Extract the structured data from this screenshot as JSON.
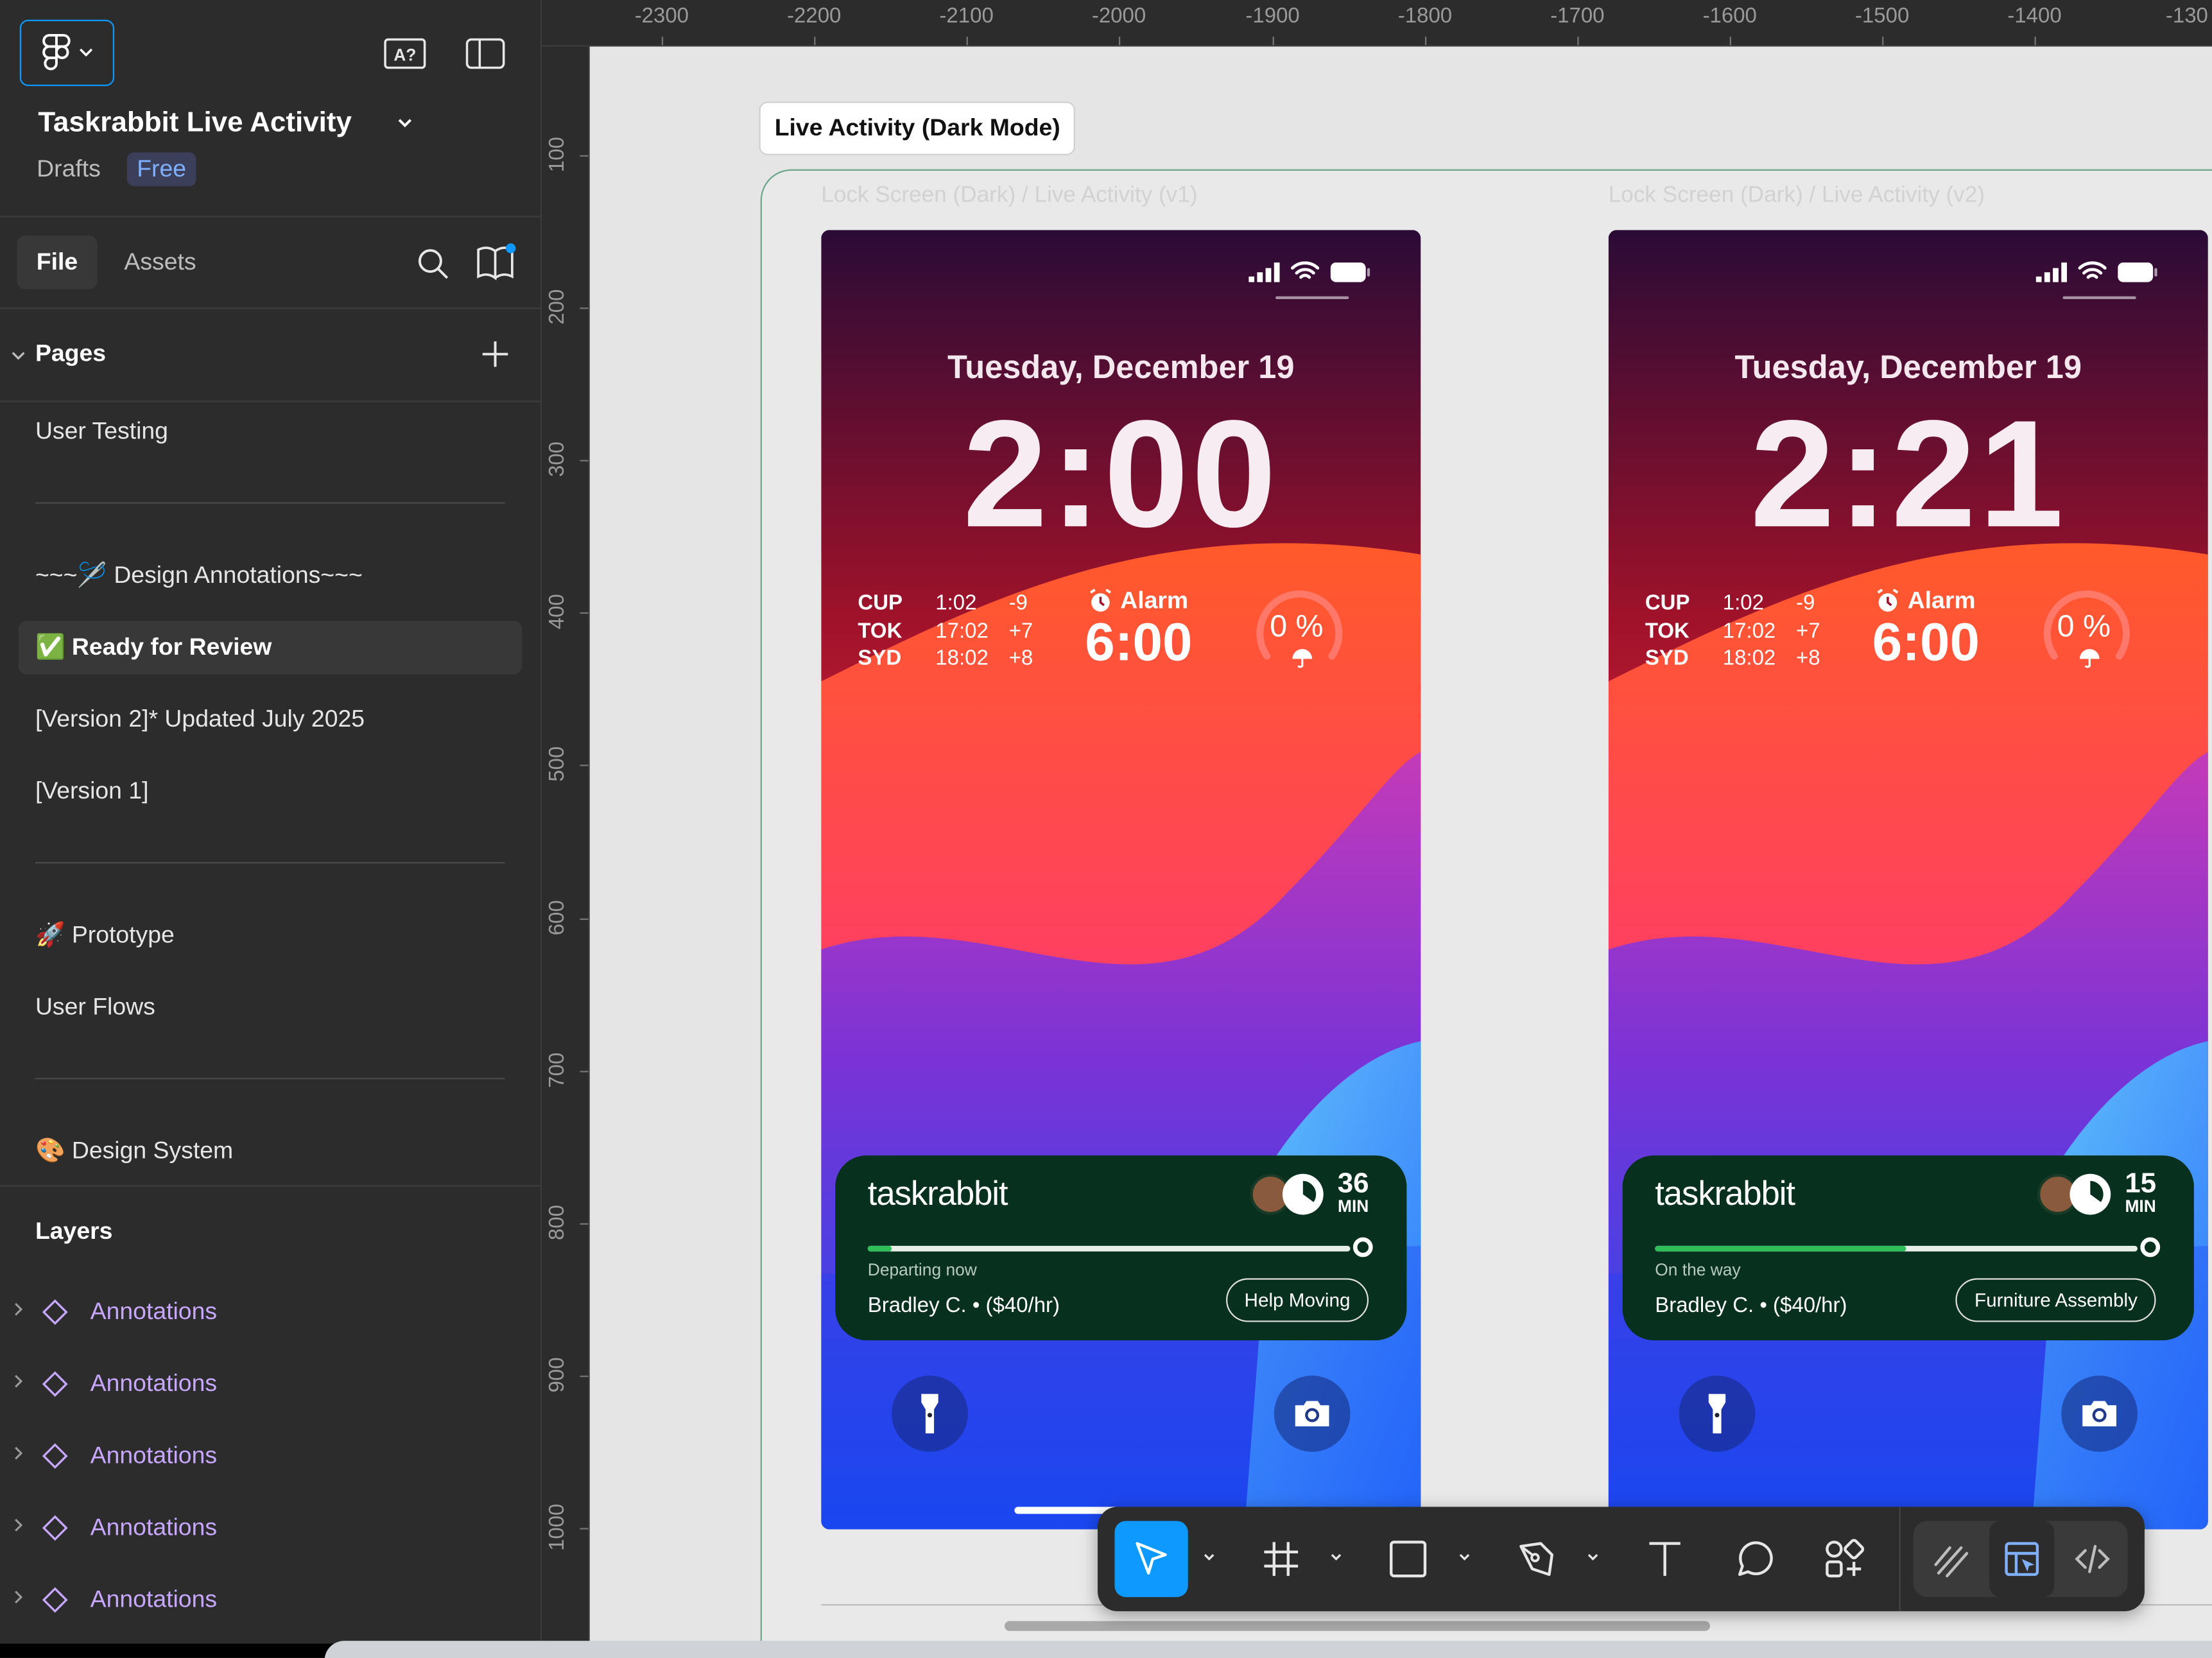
{
  "file": {
    "title": "Taskrabbit Live Activity",
    "location": "Drafts",
    "plan_badge": "Free"
  },
  "tabs": {
    "file": "File",
    "assets": "Assets"
  },
  "pages": {
    "heading": "Pages",
    "items": [
      "User Testing",
      "~~~🪡 Design Annotations~~~",
      "✅ Ready for Review",
      "[Version 2]* Updated July 2025",
      "[Version 1]",
      "🚀 Prototype",
      "User Flows",
      "🎨 Design System"
    ],
    "active": "✅ Ready for Review"
  },
  "layers": {
    "heading": "Layers",
    "items": [
      "Annotations",
      "Annotations",
      "Annotations",
      "Annotations",
      "Annotations"
    ]
  },
  "ruler": {
    "top": [
      "-2300",
      "-2200",
      "-2100",
      "-2000",
      "-1900",
      "-1800",
      "-1700",
      "-1600",
      "-1500",
      "-1400",
      "-130"
    ],
    "left": [
      "100",
      "200",
      "300",
      "400",
      "500",
      "600",
      "700",
      "800",
      "900",
      "1000"
    ]
  },
  "canvas": {
    "section_label": "Live Activity (Dark Mode)",
    "frames": [
      {
        "label": "Lock Screen (Dark) / Live Activity (v1)",
        "date": "Tuesday, December 19",
        "time": "2:00",
        "world_clock": [
          {
            "city": "CUP",
            "time": "1:02",
            "offset": "-9"
          },
          {
            "city": "TOK",
            "time": "17:02",
            "offset": "+7"
          },
          {
            "city": "SYD",
            "time": "18:02",
            "offset": "+8"
          }
        ],
        "alarm_label": "Alarm",
        "alarm_time": "6:00",
        "rain": "0 %",
        "live_activity": {
          "brand": "taskrabbit",
          "eta_value": "36",
          "eta_unit": "MIN",
          "progress": 0.05,
          "status": "Departing now",
          "tasker": "Bradley C. • ($40/hr)",
          "task": "Help Moving"
        }
      },
      {
        "label": "Lock Screen (Dark) / Live Activity (v2)",
        "date": "Tuesday, December 19",
        "time": "2:21",
        "world_clock": [
          {
            "city": "CUP",
            "time": "1:02",
            "offset": "-9"
          },
          {
            "city": "TOK",
            "time": "17:02",
            "offset": "+7"
          },
          {
            "city": "SYD",
            "time": "18:02",
            "offset": "+8"
          }
        ],
        "alarm_label": "Alarm",
        "alarm_time": "6:00",
        "rain": "0 %",
        "live_activity": {
          "brand": "taskrabbit",
          "eta_value": "15",
          "eta_unit": "MIN",
          "progress": 0.52,
          "status": "On the way",
          "tasker": "Bradley C. • ($40/hr)",
          "task": "Furniture Assembly"
        }
      }
    ]
  },
  "toolbar": {
    "tools": [
      "move-tool",
      "frame-tool",
      "shape-tool",
      "pen-tool",
      "text-tool",
      "comment-tool",
      "assets-tool",
      "draw-mode",
      "design-mode",
      "dev-mode"
    ],
    "active_tool": "move-tool",
    "accent": "#0d99ff"
  },
  "colors": {
    "accent": "#0d99ff",
    "layer_component": "#c7a7ff",
    "live_activity_bg": "#07301e",
    "progress_fill": "#2fbf5a"
  }
}
